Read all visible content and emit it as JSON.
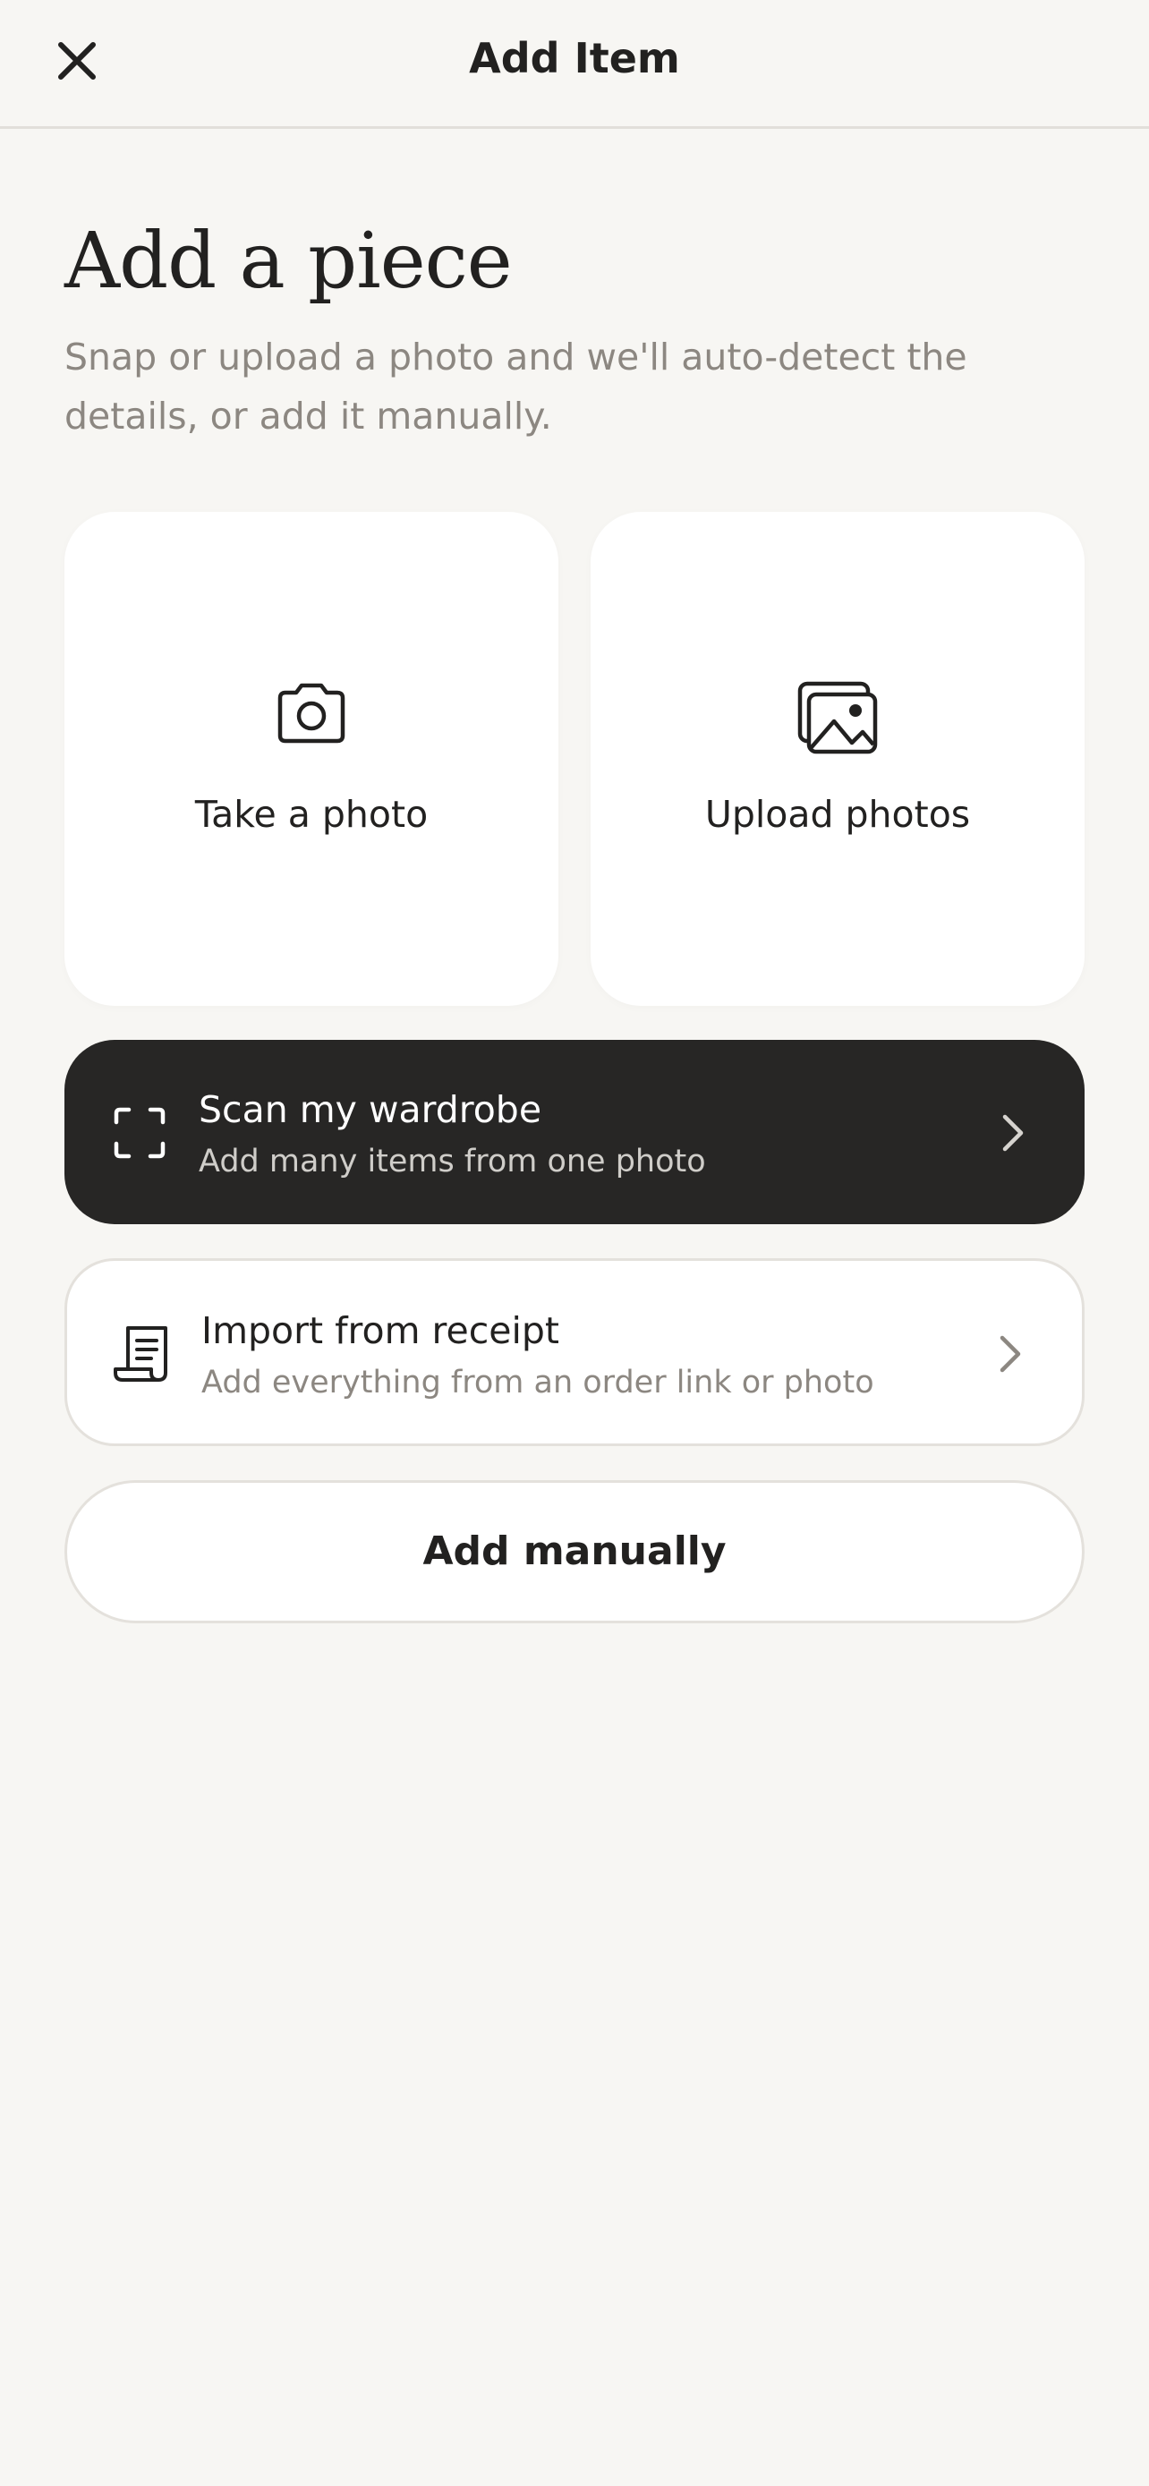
{
  "header": {
    "title": "Add Item",
    "close_icon": "close-icon"
  },
  "intro": {
    "title": "Add a piece",
    "subtitle": "Snap or upload a photo and we'll auto-detect the details, or add it manually."
  },
  "tiles": [
    {
      "label": "Take a photo",
      "icon": "camera-icon"
    },
    {
      "label": "Upload photos",
      "icon": "image-gallery-icon"
    }
  ],
  "actions": {
    "scan": {
      "title": "Scan my wardrobe",
      "subtitle": "Add many items from one photo",
      "icon": "scan-frame-icon"
    },
    "receipt": {
      "title": "Import from receipt",
      "subtitle": "Add everything from an order link or photo",
      "icon": "receipt-icon"
    },
    "manual_label": "Add manually"
  },
  "colors": {
    "background": "#f7f6f3",
    "dark_card": "#272625",
    "muted_text": "#8c8781",
    "primary_text": "#222120"
  }
}
